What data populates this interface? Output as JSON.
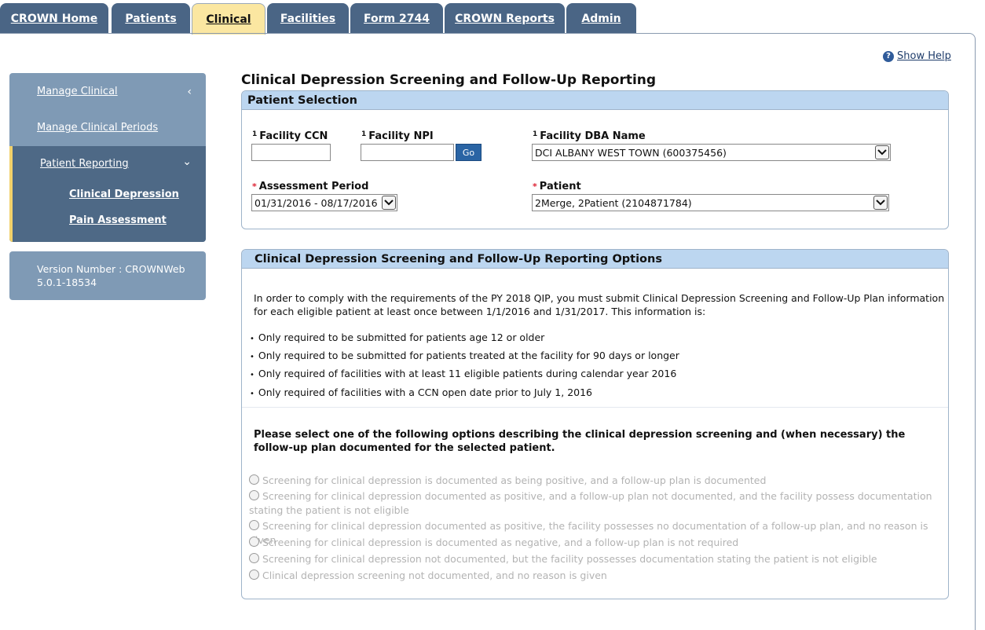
{
  "tabs": [
    {
      "label": "CROWN Home"
    },
    {
      "label": "Patients"
    },
    {
      "label": "Clinical"
    },
    {
      "label": "Facilities"
    },
    {
      "label": "Form 2744"
    },
    {
      "label": "CROWN Reports"
    },
    {
      "label": "Admin"
    }
  ],
  "active_tab": "Clinical",
  "help": {
    "icon": "help-question-icon",
    "label": "Show Help"
  },
  "sidebar": {
    "items": [
      {
        "label": "Manage Clinical",
        "icon": "chevron-left-icon",
        "chevron": "‹"
      },
      {
        "label": "Manage Clinical Periods"
      }
    ],
    "group": {
      "label": "Patient Reporting",
      "icon": "chevron-down-icon",
      "chevron": "⌄",
      "children": [
        {
          "label": "Clinical Depression"
        },
        {
          "label": "Pain Assessment"
        }
      ]
    },
    "version": "Version Number : CROWNWeb 5.0.1-18534"
  },
  "page_title": "Clinical Depression Screening and Follow-Up Reporting",
  "patient_selection": {
    "heading": "Patient Selection",
    "ccn_marker": "1",
    "ccn_label": "Facility CCN",
    "ccn_value": "",
    "npi_marker": "1",
    "npi_label": "Facility NPI",
    "npi_value": "",
    "go_label": "Go",
    "dba_marker": "1",
    "dba_label": "Facility DBA Name",
    "dba_value": "DCI ALBANY WEST TOWN (600375456)",
    "period_required": "*",
    "period_label": "Assessment Period",
    "period_value": "01/31/2016 - 08/17/2016",
    "patient_required": "*",
    "patient_label": "Patient",
    "patient_value": "2Merge, 2Patient (2104871784)"
  },
  "options_panel": {
    "heading": "Clinical Depression Screening and Follow-Up Reporting Options",
    "intro": "In order to comply with the requirements of the PY 2018 QIP, you must submit Clinical Depression Screening and Follow-Up Plan information for each eligible patient at least once between 1/1/2016 and 1/31/2017. This information is:",
    "bullet_glyph": "•",
    "bullets": [
      "Only required to be submitted for patients age 12 or older",
      "Only required to be submitted for patients treated at the facility for 90 days or longer",
      "Only required of facilities with at least 11 eligible patients during calendar year 2016",
      "Only required of facilities with a CCN open date prior to July 1, 2016"
    ],
    "instruction": "Please select one of the following options describing the clinical depression screening and (when necessary) the follow-up plan documented for the selected patient.",
    "options": [
      "Screening for clinical depression is documented as being positive, and a follow-up plan is documented",
      "Screening for clinical depression documented as positive, and a follow-up plan not documented, and the facility possess documentation stating the patient is not eligible",
      "Screening for clinical depression documented as positive, the facility possesses no documentation of a follow-up plan, and no reason is given",
      "Screening for clinical depression is documented as negative, and a follow-up plan is not required",
      "Screening for clinical depression not documented, but the facility possesses documentation stating the patient is not eligible",
      "Clinical depression screening not documented, and no reason is given"
    ]
  },
  "colors": {
    "tab": "#4a6585",
    "tab_active": "#fbe7a1",
    "sidebar": "#7f9ab5",
    "sidebar_active": "#4e6986",
    "panel_header": "#bcd6f0",
    "go_button": "#2a64a4"
  }
}
